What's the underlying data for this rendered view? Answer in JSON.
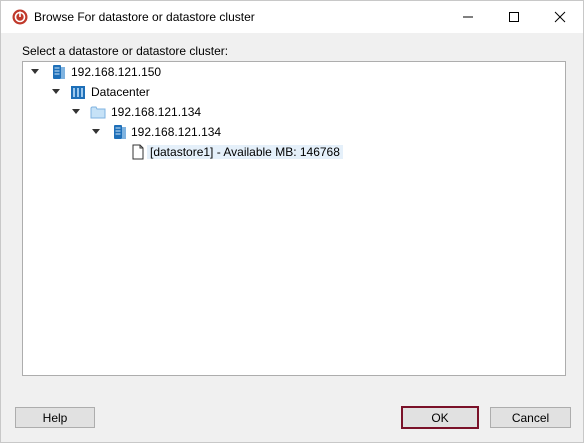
{
  "window": {
    "title": "Browse For datastore or datastore cluster"
  },
  "dialog": {
    "prompt": "Select a datastore or datastore cluster:"
  },
  "tree": {
    "nodes": [
      {
        "label": "192.168.121.150",
        "icon": "server-icon",
        "expanded": true
      },
      {
        "label": "Datacenter",
        "icon": "datacenter-icon",
        "expanded": true
      },
      {
        "label": "192.168.121.134",
        "icon": "folder-icon",
        "expanded": true
      },
      {
        "label": "192.168.121.134",
        "icon": "host-icon",
        "expanded": true
      },
      {
        "label": "[datastore1] - Available MB: 146768",
        "icon": "datastore-icon",
        "selected": true
      }
    ]
  },
  "buttons": {
    "help": "Help",
    "ok": "OK",
    "cancel": "Cancel"
  },
  "colors": {
    "ok_border": "#7a1129",
    "app_icon": "#c0392b",
    "selection": "#e5f0fa"
  }
}
